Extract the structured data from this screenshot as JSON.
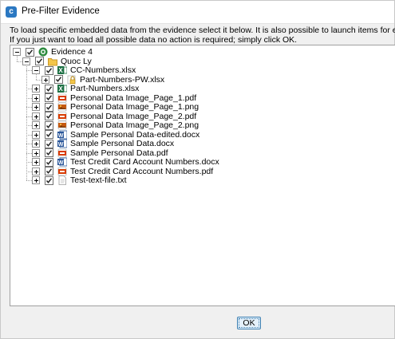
{
  "window": {
    "title": "Pre-Filter Evidence"
  },
  "description": {
    "line1": "To load specific embedded data from the evidence select it below. It is also possible to launch items for external inspection by rig",
    "line2": "If you just want to load all possible data no action is required; simply click OK."
  },
  "tree": {
    "root": {
      "label": "Evidence 4",
      "expanded": true,
      "checked": true,
      "icon": "evidence-icon"
    },
    "user": {
      "label": "Quoc Ly",
      "expanded": true,
      "checked": true,
      "icon": "folder-icon"
    },
    "items": [
      {
        "label": "CC-Numbers.xlsx",
        "icon": "excel-icon",
        "checked": true,
        "expanded": true
      },
      {
        "label": "Part-Numbers-PW.xlsx",
        "icon": "lock-icon",
        "checked": true,
        "expanded": false,
        "child": true
      },
      {
        "label": "Part-Numbers.xlsx",
        "icon": "excel-icon",
        "checked": true,
        "expanded": false
      },
      {
        "label": "Personal Data Image_Page_1.pdf",
        "icon": "pdf-icon",
        "checked": true,
        "expanded": false
      },
      {
        "label": "Personal Data Image_Page_1.png",
        "icon": "png-icon",
        "checked": true,
        "expanded": false
      },
      {
        "label": "Personal Data Image_Page_2.pdf",
        "icon": "pdf-icon",
        "checked": true,
        "expanded": false
      },
      {
        "label": "Personal Data Image_Page_2.png",
        "icon": "png-icon",
        "checked": true,
        "expanded": false
      },
      {
        "label": "Sample Personal Data-edited.docx",
        "icon": "word-icon",
        "checked": true,
        "expanded": false
      },
      {
        "label": "Sample Personal Data.docx",
        "icon": "word-icon",
        "checked": true,
        "expanded": false
      },
      {
        "label": "Sample Personal Data.pdf",
        "icon": "pdf-icon",
        "checked": true,
        "expanded": false
      },
      {
        "label": "Test Credit Card Account Numbers.docx",
        "icon": "word-icon",
        "checked": true,
        "expanded": false
      },
      {
        "label": "Test Credit Card Account Numbers.pdf",
        "icon": "pdf-icon",
        "checked": true,
        "expanded": false
      },
      {
        "label": "Test-text-file.txt",
        "icon": "text-file-icon",
        "checked": true,
        "expanded": false
      }
    ]
  },
  "buttons": {
    "ok": "OK"
  },
  "colors": {
    "excel": "#1e7145",
    "word": "#2b579a",
    "pdf": "#d83b01",
    "png": "#c55a11",
    "accent": "#3c7fb1"
  }
}
